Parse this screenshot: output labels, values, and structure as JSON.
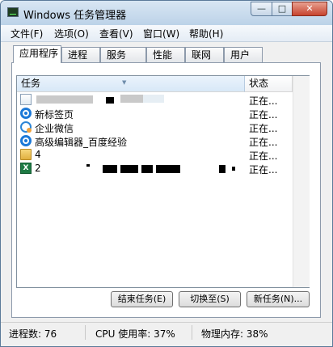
{
  "window": {
    "title": "Windows 任务管理器",
    "controls": {
      "minimize": "—",
      "maximize": "□",
      "close": "✕"
    }
  },
  "menu": [
    "文件(F)",
    "选项(O)",
    "查看(V)",
    "窗口(W)",
    "帮助(H)"
  ],
  "tabs": [
    "应用程序",
    "进程",
    "服务",
    "性能",
    "联网",
    "用户"
  ],
  "active_tab": "应用程序",
  "columns": {
    "task": "任务",
    "status": "状态"
  },
  "rows": [
    {
      "icon": "document-icon",
      "name": "",
      "status": "正在..."
    },
    {
      "icon": "browser-icon",
      "name": "新标签页",
      "status": "正在..."
    },
    {
      "icon": "wechat-work-icon",
      "name": "企业微信",
      "status": "正在..."
    },
    {
      "icon": "browser-icon",
      "name": "高级编辑器_百度经验",
      "status": "正在..."
    },
    {
      "icon": "folder-icon",
      "name": "4",
      "status": "正在..."
    },
    {
      "icon": "excel-icon",
      "name": "2",
      "status": "正在..."
    }
  ],
  "buttons": {
    "end_task": "结束任务(E)",
    "switch_to": "切换至(S)",
    "new_task": "新任务(N)..."
  },
  "statusbar": {
    "processes": "进程数: 76",
    "cpu": "CPU 使用率: 37%",
    "memory": "物理内存: 38%"
  },
  "colors": {
    "title_bar": "#c9dcee",
    "close_button": "#c7432e",
    "selected_header": "#d8e8f7"
  }
}
